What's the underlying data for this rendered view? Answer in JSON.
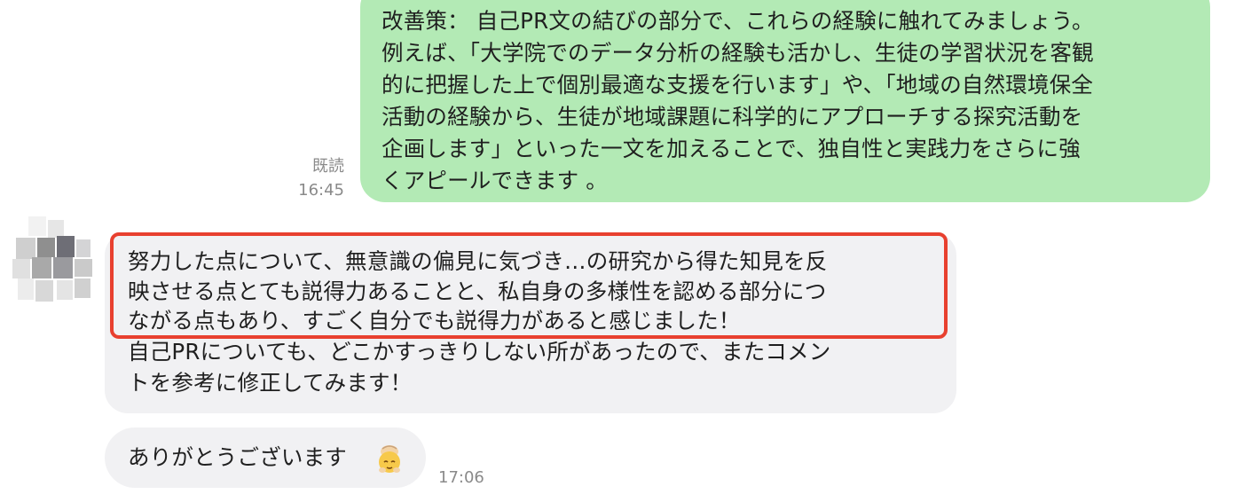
{
  "sent_message": {
    "text": "改善策： 自己PR文の結びの部分で、これらの経験に触れてみましょう。\n例えば、「大学院でのデータ分析の経験も活かし、生徒の学習状況を客観\n的に把握した上で個別最適な支援を行います」や、「地域の自然環境保全\n活動の経験から、生徒が地域課題に科学的にアプローチする探究活動を\n企画します」といった一文を加えることで、独自性と実践力をさらに強\nくアピールできます 。",
    "read_label": "既読",
    "time": "16:45"
  },
  "received_message": {
    "lines": [
      "努力した点について、無意識の偏見に気づき…の研究から得た知見を反",
      "映させる点とても説得力あることと、私自身の多様性を認める部分につ",
      "ながる点もあり、すごく自分でも説得力があると感じました！",
      "自己PRについても、どこかすっきりしない所があったので、またコメン",
      "トを参考に修正してみます！"
    ]
  },
  "received_message_2": {
    "text": "ありがとうございます",
    "emoji": "bowing-face-emoji",
    "time": "17:06"
  },
  "colors": {
    "sent_bubble": "#b3eab5",
    "received_bubble": "#f1f1f3",
    "highlight_border": "#e8402f"
  }
}
